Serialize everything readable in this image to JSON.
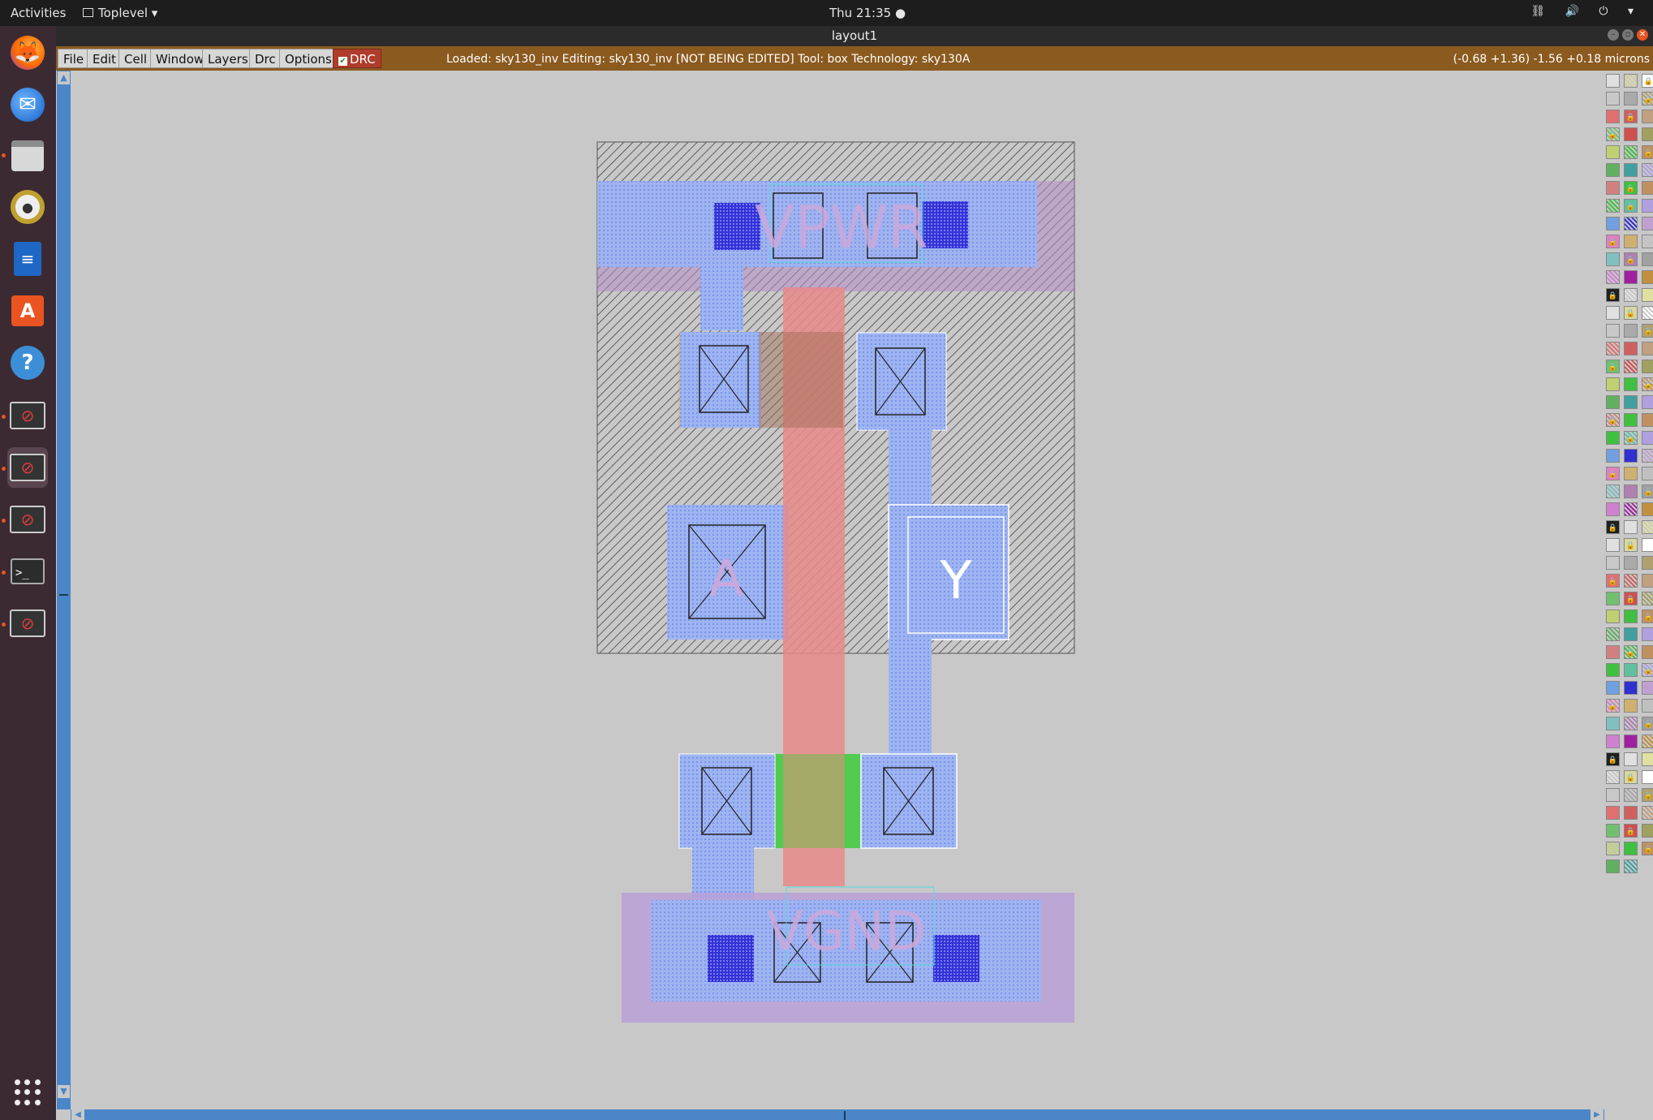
{
  "system_bar": {
    "activities": "Activities",
    "app_name": "Toplevel",
    "clock": "Thu 21:35",
    "tray": "⛓ 🔊 ⏻ ▾"
  },
  "window": {
    "title": "layout1"
  },
  "menu": {
    "items": [
      "File",
      "Edit",
      "Cell",
      "Window",
      "Layers",
      "Drc",
      "Options"
    ],
    "drc_toggle": "DRC"
  },
  "status": {
    "text": "Loaded: sky130_inv Editing: sky130_inv [NOT BEING EDITED] Tool: box  Technology: sky130A",
    "coords": "(-0.68 +1.36) -1.56 +0.18 microns"
  },
  "layout": {
    "labels": {
      "vpwr": "VPWR",
      "vgnd": "VGND",
      "input": "A",
      "output": "Y"
    }
  },
  "dock": {
    "apps": [
      "firefox",
      "thunderbird",
      "files",
      "rhythmbox",
      "writer",
      "software-center",
      "help",
      "blocked-app",
      "blocked-app",
      "blocked-app",
      "terminal",
      "blocked-app"
    ]
  },
  "colors": {
    "menubar": "#8b5a1e",
    "metal": "#7f9fee",
    "poly": "#e98a8a",
    "nwell": "#b48ec8",
    "diff": "#44cc44",
    "scroll": "#4a86c8"
  }
}
